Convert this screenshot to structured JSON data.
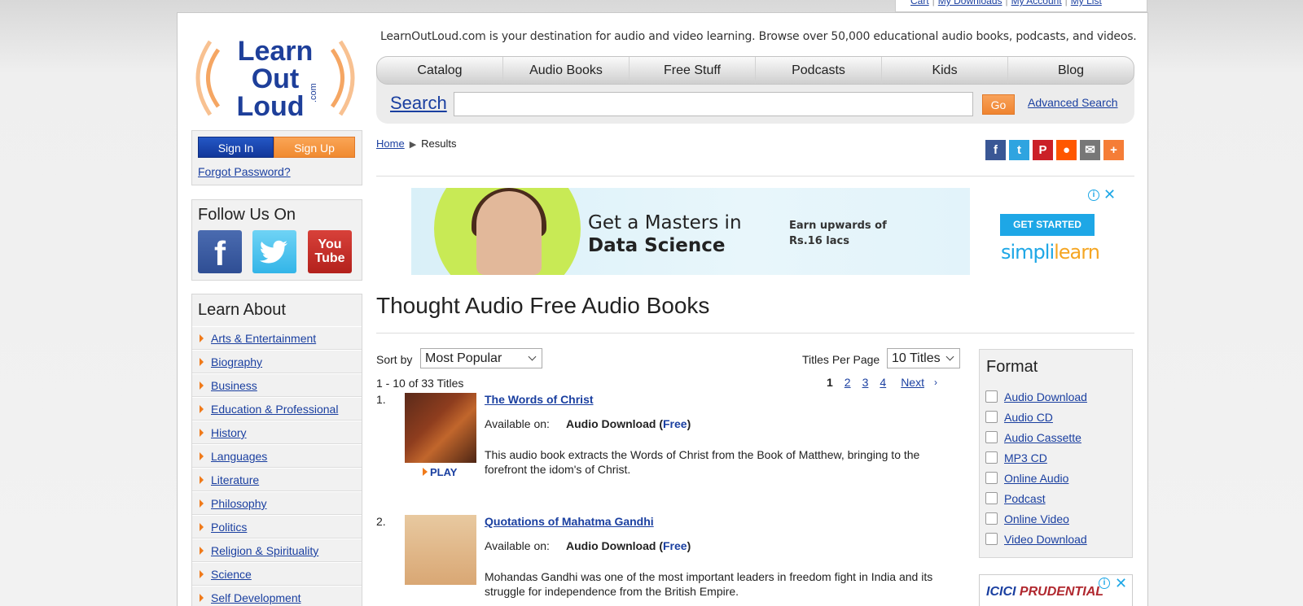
{
  "top_links": {
    "cart": "Cart",
    "downloads": "My Downloads",
    "account": "My Account",
    "list": "My List"
  },
  "header": {
    "logo": {
      "line1": "Learn",
      "line2": "Out",
      "line3": "Loud",
      "suffix": ".com"
    },
    "tagline": "LearnOutLoud.com is your destination for audio and video learning. Browse over 50,000 educational audio books, podcasts, and videos."
  },
  "nav": [
    "Catalog",
    "Audio Books",
    "Free Stuff",
    "Podcasts",
    "Kids",
    "Blog"
  ],
  "search": {
    "label": "Search",
    "value": "",
    "go_label": "Go",
    "advanced_label": "Advanced Search"
  },
  "account": {
    "signin_label": "Sign In",
    "signup_label": "Sign Up",
    "forgot_label": "Forgot Password?"
  },
  "follow": {
    "title": "Follow Us On",
    "icons": [
      "facebook-icon",
      "twitter-icon",
      "youtube-icon"
    ],
    "youtube_text_1": "You",
    "youtube_text_2": "Tube"
  },
  "learn_about": {
    "title": "Learn About",
    "items": [
      "Arts & Entertainment",
      "Biography",
      "Business",
      "Education & Professional",
      "History",
      "Languages",
      "Literature",
      "Philosophy",
      "Politics",
      "Religion & Spirituality",
      "Science",
      "Self Development"
    ]
  },
  "breadcrumb": {
    "home": "Home",
    "current": "Results"
  },
  "share_icons": [
    "facebook-icon",
    "twitter-icon",
    "pinterest-icon",
    "reddit-icon",
    "email-icon",
    "plus-icon"
  ],
  "ad_banner": {
    "headline_1": "Get a Masters in",
    "headline_2": "Data Science",
    "earn_1": "Earn upwards of",
    "earn_2": "Rs.16 lacs",
    "cta": "GET STARTED",
    "brand_1": "simpli",
    "brand_2": "learn"
  },
  "page_title": "Thought Audio Free Audio Books",
  "sort": {
    "label": "Sort by",
    "selected": "Most Popular"
  },
  "titles_per_page": {
    "label": "Titles Per Page",
    "selected": "10 Titles"
  },
  "result_count": "1 - 10 of 33 Titles",
  "pager": {
    "current": "1",
    "pages": [
      "2",
      "3",
      "4"
    ],
    "next_label": "Next",
    "next_icon": "›"
  },
  "results": [
    {
      "num": "1.",
      "title": "The Words of Christ",
      "available_label": "Available on:",
      "format": "Audio Download",
      "price": "Free",
      "description": "This audio book extracts the Words of Christ from the Book of Matthew, bringing to the forefront the idom's of Christ.",
      "play_label": "PLAY"
    },
    {
      "num": "2.",
      "title": "Quotations of Mahatma Gandhi",
      "available_label": "Available on:",
      "format": "Audio Download",
      "price": "Free",
      "description": "Mohandas Gandhi was one of the most important leaders in freedom fight in India and its struggle for independence from the British Empire."
    }
  ],
  "format_filter": {
    "title": "Format",
    "options": [
      "Audio Download",
      "Audio CD",
      "Audio Cassette",
      "MP3 CD",
      "Online Audio",
      "Podcast",
      "Online Video",
      "Video Download"
    ]
  },
  "ad_side": {
    "brand_1": "ICICI",
    "brand_2": "PRUDENTIAL"
  },
  "colors": {
    "accent_orange": "#f07a1a",
    "link_blue": "#1a3fa0",
    "signin_blue": "#12379a"
  }
}
